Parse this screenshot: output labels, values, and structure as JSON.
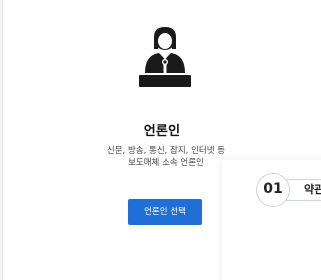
{
  "card": {
    "icon": "journalist-podium-icon",
    "title": "언론인",
    "desc_line1": "신문, 방송, 통신, 잡지, 인터넷 등",
    "desc_line2": "보도매체 소속 언론인",
    "button_label": "언론인 선택"
  },
  "step": {
    "number": "01",
    "label": "약관"
  },
  "colors": {
    "accent": "#1f6fd6",
    "icon": "#1a1a1a"
  }
}
